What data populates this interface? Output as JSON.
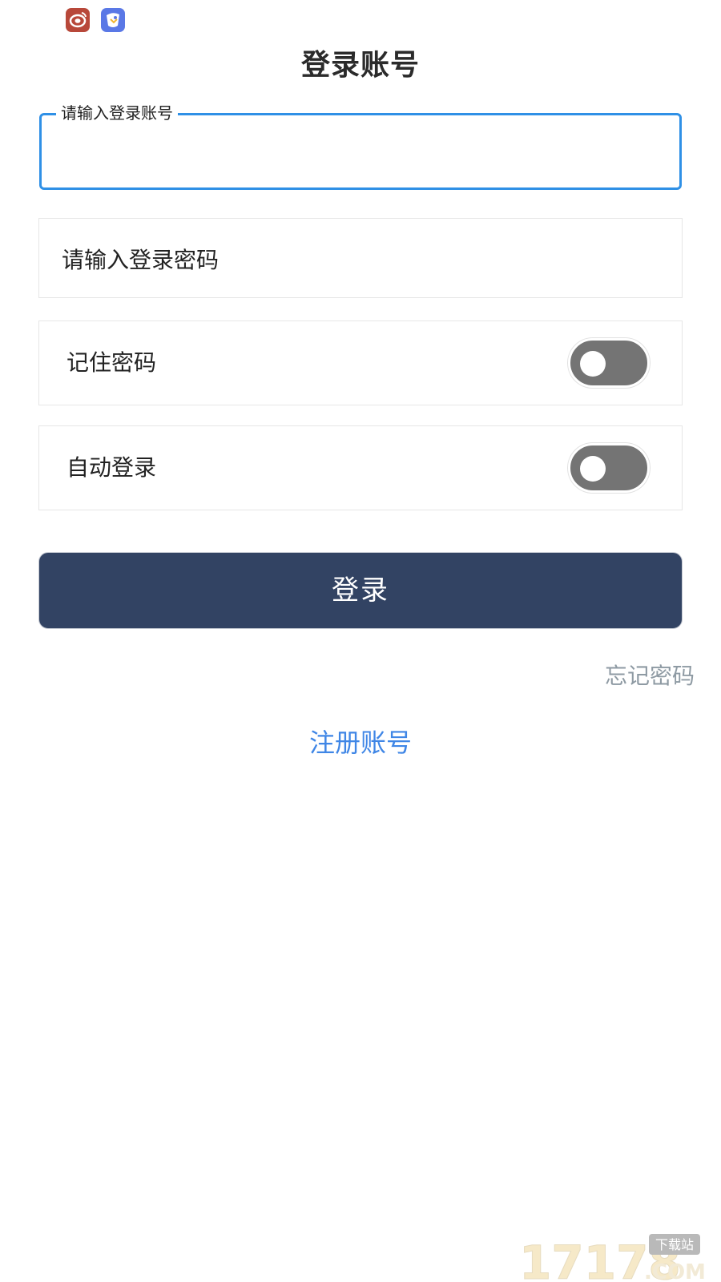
{
  "status_bar": {
    "icons": [
      "weibo-icon",
      "app-bird-icon"
    ]
  },
  "page": {
    "title": "登录账号"
  },
  "account": {
    "label": "请输入登录账号",
    "value": ""
  },
  "password": {
    "placeholder": "请输入登录密码",
    "value": ""
  },
  "options": {
    "remember_password": {
      "label": "记住密码",
      "enabled": false
    },
    "auto_login": {
      "label": "自动登录",
      "enabled": false
    }
  },
  "actions": {
    "login_label": "登录",
    "forgot_label": "忘记密码",
    "register_label": "注册账号"
  },
  "watermark": {
    "text": "17178",
    "suffix": ".COM",
    "badge": "下载站"
  },
  "colors": {
    "focus_border": "#2f90e6",
    "primary_button": "#324363",
    "toggle_off": "#747474",
    "link_blue": "#3f86e6",
    "muted_link": "#8e9aa3"
  }
}
